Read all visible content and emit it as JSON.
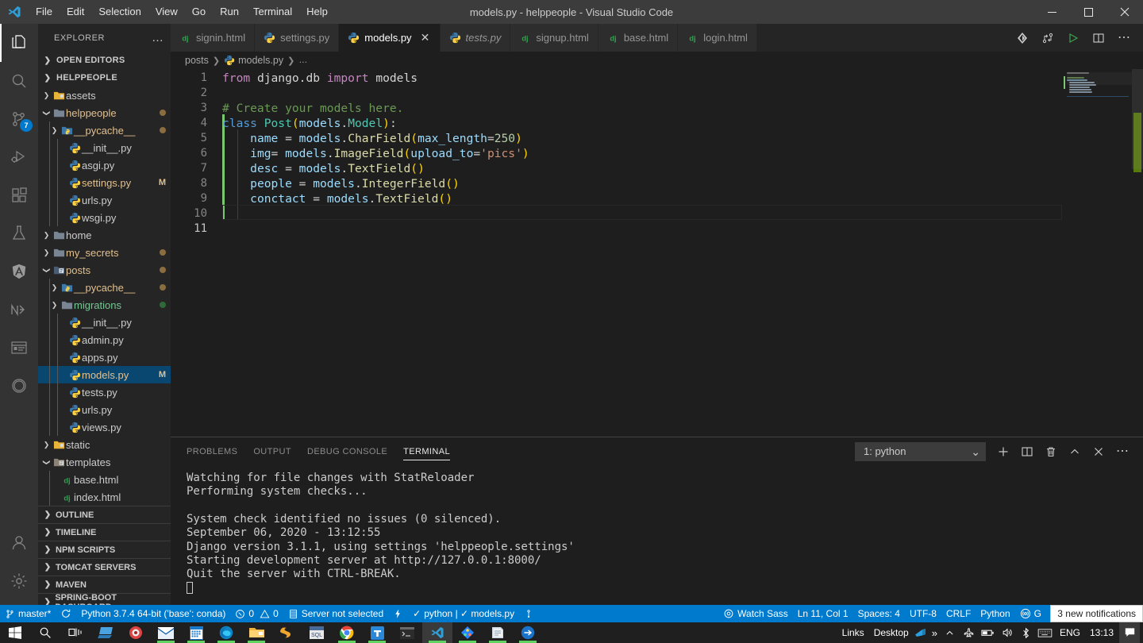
{
  "window": {
    "title": "models.py - helppeople - Visual Studio Code",
    "menu": [
      "File",
      "Edit",
      "Selection",
      "View",
      "Go",
      "Run",
      "Terminal",
      "Help"
    ],
    "controls": {
      "minimize": "─",
      "maximize": "☐",
      "close": "✕"
    }
  },
  "activitybar": {
    "items": [
      {
        "name": "explorer",
        "icon": "files-icon",
        "active": true,
        "badge": ""
      },
      {
        "name": "search",
        "icon": "search-icon",
        "active": false,
        "badge": ""
      },
      {
        "name": "source-control",
        "icon": "source-control-icon",
        "active": false,
        "badge": "7"
      },
      {
        "name": "run-and-debug",
        "icon": "run-debug-icon",
        "active": false,
        "badge": ""
      },
      {
        "name": "extensions",
        "icon": "extensions-icon",
        "active": false,
        "badge": ""
      },
      {
        "name": "testing",
        "icon": "beaker-icon",
        "active": false,
        "badge": ""
      },
      {
        "name": "angular",
        "icon": "angular-icon",
        "active": false,
        "badge": ""
      },
      {
        "name": "nx-console",
        "icon": "nx-icon",
        "active": false,
        "badge": ""
      },
      {
        "name": "browser-preview",
        "icon": "browser-icon",
        "active": false,
        "badge": ""
      },
      {
        "name": "circle-tool",
        "icon": "circle-icon",
        "active": false,
        "badge": ""
      }
    ],
    "bottom": [
      {
        "name": "accounts",
        "icon": "account-icon"
      },
      {
        "name": "manage-settings",
        "icon": "gear-icon"
      }
    ]
  },
  "sidebar": {
    "header": "EXPLORER",
    "more_actions": "…",
    "open_editors": {
      "label": "OPEN EDITORS",
      "expanded": false
    },
    "project": {
      "label": "HELPPEOPLE",
      "expanded": true
    },
    "tree": [
      {
        "label": "assets",
        "depth": 1,
        "type": "folder-assets",
        "chev": "collapsed",
        "status": "",
        "mod": ""
      },
      {
        "label": "helppeople",
        "depth": 1,
        "type": "folder",
        "chev": "expanded",
        "status": "amber",
        "mod": ""
      },
      {
        "label": "__pycache__",
        "depth": 2,
        "type": "folder-py",
        "chev": "collapsed",
        "status": "amber",
        "mod": ""
      },
      {
        "label": "__init__.py",
        "depth": 3,
        "type": "python",
        "chev": "none",
        "status": "",
        "mod": ""
      },
      {
        "label": "asgi.py",
        "depth": 3,
        "type": "python",
        "chev": "none",
        "status": "",
        "mod": ""
      },
      {
        "label": "settings.py",
        "depth": 3,
        "type": "python",
        "chev": "none",
        "status": "",
        "mod": "M"
      },
      {
        "label": "urls.py",
        "depth": 3,
        "type": "python",
        "chev": "none",
        "status": "",
        "mod": ""
      },
      {
        "label": "wsgi.py",
        "depth": 3,
        "type": "python",
        "chev": "none",
        "status": "",
        "mod": ""
      },
      {
        "label": "home",
        "depth": 1,
        "type": "folder-grey",
        "chev": "collapsed",
        "status": "",
        "mod": ""
      },
      {
        "label": "my_secrets",
        "depth": 1,
        "type": "folder-grey",
        "chev": "collapsed",
        "status": "amber",
        "mod": ""
      },
      {
        "label": "posts",
        "depth": 1,
        "type": "folder-open",
        "chev": "expanded",
        "status": "amber",
        "mod": ""
      },
      {
        "label": "__pycache__",
        "depth": 2,
        "type": "folder-py",
        "chev": "collapsed",
        "status": "amber",
        "mod": ""
      },
      {
        "label": "migrations",
        "depth": 2,
        "type": "folder-grey",
        "chev": "collapsed",
        "status": "green",
        "mod": "",
        "green_label": true
      },
      {
        "label": "__init__.py",
        "depth": 3,
        "type": "python",
        "chev": "none",
        "status": "",
        "mod": ""
      },
      {
        "label": "admin.py",
        "depth": 3,
        "type": "python",
        "chev": "none",
        "status": "",
        "mod": ""
      },
      {
        "label": "apps.py",
        "depth": 3,
        "type": "python",
        "chev": "none",
        "status": "",
        "mod": ""
      },
      {
        "label": "models.py",
        "depth": 3,
        "type": "python",
        "chev": "none",
        "status": "",
        "mod": "M",
        "selected": true
      },
      {
        "label": "tests.py",
        "depth": 3,
        "type": "python",
        "chev": "none",
        "status": "",
        "mod": ""
      },
      {
        "label": "urls.py",
        "depth": 3,
        "type": "python",
        "chev": "none",
        "status": "",
        "mod": ""
      },
      {
        "label": "views.py",
        "depth": 3,
        "type": "python",
        "chev": "none",
        "status": "",
        "mod": ""
      },
      {
        "label": "static",
        "depth": 1,
        "type": "folder-assets",
        "chev": "collapsed",
        "status": "",
        "mod": ""
      },
      {
        "label": "templates",
        "depth": 1,
        "type": "folder-tpl",
        "chev": "expanded",
        "status": "",
        "mod": ""
      },
      {
        "label": "base.html",
        "depth": 2,
        "type": "django",
        "chev": "none",
        "status": "",
        "mod": ""
      },
      {
        "label": "index.html",
        "depth": 2,
        "type": "django",
        "chev": "none",
        "status": "",
        "mod": ""
      }
    ],
    "panels": [
      "OUTLINE",
      "TIMELINE",
      "NPM SCRIPTS",
      "TOMCAT SERVERS",
      "MAVEN",
      "SPRING-BOOT DASHBOARD"
    ]
  },
  "editor": {
    "tabs": [
      {
        "label": "signin.html",
        "icon": "django-icon",
        "active": false,
        "preview": false,
        "dirty": false
      },
      {
        "label": "settings.py",
        "icon": "python-icon",
        "active": false,
        "preview": false,
        "dirty": false
      },
      {
        "label": "models.py",
        "icon": "python-icon",
        "active": true,
        "preview": false,
        "dirty": false,
        "close": "✕"
      },
      {
        "label": "tests.py",
        "icon": "python-icon",
        "active": false,
        "preview": true,
        "dirty": false
      },
      {
        "label": "signup.html",
        "icon": "django-icon",
        "active": false,
        "preview": false,
        "dirty": false
      },
      {
        "label": "base.html",
        "icon": "django-icon",
        "active": false,
        "preview": false,
        "dirty": false
      },
      {
        "label": "login.html",
        "icon": "django-icon",
        "active": false,
        "preview": false,
        "dirty": false
      }
    ],
    "tab_actions": [
      {
        "name": "source-control-graph-icon",
        "glyph": "◆"
      },
      {
        "name": "git-compare-icon",
        "glyph": "⑂"
      },
      {
        "name": "run-python-file-icon",
        "glyph": "▷"
      },
      {
        "name": "split-editor-icon",
        "glyph": "◫"
      },
      {
        "name": "more-actions-icon",
        "glyph": "…"
      }
    ],
    "breadcrumb": [
      "posts",
      "models.py",
      "…"
    ],
    "lines": [
      {
        "n": "1",
        "tokens": [
          {
            "t": "from",
            "c": "kw"
          },
          {
            "t": " django.db ",
            "c": "pl"
          },
          {
            "t": "import",
            "c": "kw"
          },
          {
            "t": " models",
            "c": "pl"
          }
        ]
      },
      {
        "n": "2",
        "tokens": []
      },
      {
        "n": "3",
        "tokens": [
          {
            "t": "# Create your models here.",
            "c": "cmt"
          }
        ]
      },
      {
        "n": "4",
        "tokens": [
          {
            "t": "class",
            "c": "kw2"
          },
          {
            "t": " ",
            "c": "pl"
          },
          {
            "t": "Post",
            "c": "cls"
          },
          {
            "t": "(",
            "c": "par"
          },
          {
            "t": "models",
            "c": "var"
          },
          {
            "t": ".",
            "c": "op"
          },
          {
            "t": "Model",
            "c": "cls"
          },
          {
            "t": ")",
            "c": "par"
          },
          {
            "t": ":",
            "c": "op"
          }
        ]
      },
      {
        "n": "5",
        "tokens": [
          {
            "t": "    ",
            "c": "pl"
          },
          {
            "t": "name",
            "c": "var"
          },
          {
            "t": " = ",
            "c": "op"
          },
          {
            "t": "models",
            "c": "var"
          },
          {
            "t": ".",
            "c": "op"
          },
          {
            "t": "CharField",
            "c": "fn"
          },
          {
            "t": "(",
            "c": "par"
          },
          {
            "t": "max_length",
            "c": "var"
          },
          {
            "t": "=",
            "c": "op"
          },
          {
            "t": "250",
            "c": "num"
          },
          {
            "t": ")",
            "c": "par"
          }
        ]
      },
      {
        "n": "6",
        "tokens": [
          {
            "t": "    ",
            "c": "pl"
          },
          {
            "t": "img",
            "c": "var"
          },
          {
            "t": "= ",
            "c": "op"
          },
          {
            "t": "models",
            "c": "var"
          },
          {
            "t": ".",
            "c": "op"
          },
          {
            "t": "ImageField",
            "c": "fn"
          },
          {
            "t": "(",
            "c": "par"
          },
          {
            "t": "upload_to",
            "c": "var"
          },
          {
            "t": "=",
            "c": "op"
          },
          {
            "t": "'pics'",
            "c": "str"
          },
          {
            "t": ")",
            "c": "par"
          }
        ]
      },
      {
        "n": "7",
        "tokens": [
          {
            "t": "    ",
            "c": "pl"
          },
          {
            "t": "desc",
            "c": "var"
          },
          {
            "t": " = ",
            "c": "op"
          },
          {
            "t": "models",
            "c": "var"
          },
          {
            "t": ".",
            "c": "op"
          },
          {
            "t": "TextField",
            "c": "fn"
          },
          {
            "t": "(",
            "c": "par"
          },
          {
            "t": ")",
            "c": "par"
          }
        ]
      },
      {
        "n": "8",
        "tokens": [
          {
            "t": "    ",
            "c": "pl"
          },
          {
            "t": "people",
            "c": "var"
          },
          {
            "t": " = ",
            "c": "op"
          },
          {
            "t": "models",
            "c": "var"
          },
          {
            "t": ".",
            "c": "op"
          },
          {
            "t": "IntegerField",
            "c": "fn"
          },
          {
            "t": "(",
            "c": "par"
          },
          {
            "t": ")",
            "c": "par"
          }
        ]
      },
      {
        "n": "9",
        "tokens": [
          {
            "t": "    ",
            "c": "pl"
          },
          {
            "t": "conctact",
            "c": "var"
          },
          {
            "t": " = ",
            "c": "op"
          },
          {
            "t": "models",
            "c": "var"
          },
          {
            "t": ".",
            "c": "op"
          },
          {
            "t": "TextField",
            "c": "fn"
          },
          {
            "t": "(",
            "c": "par"
          },
          {
            "t": ")",
            "c": "par"
          }
        ]
      },
      {
        "n": "10",
        "tokens": []
      },
      {
        "n": "11",
        "tokens": [],
        "current": true
      }
    ],
    "plain_text": "from django.db import models\n\n# Create your models here.\nclass Post(models.Model):\n    name = models.CharField(max_length=250)\n    img= models.ImageField(upload_to='pics')\n    desc = models.TextField()\n    people = models.IntegerField()\n    conctact = models.TextField()\n\n"
  },
  "panel": {
    "tabs": [
      "PROBLEMS",
      "OUTPUT",
      "DEBUG CONSOLE",
      "TERMINAL"
    ],
    "active_tab": "TERMINAL",
    "terminal_select": "1: python",
    "select_chevron": "⌄",
    "actions": [
      {
        "name": "new-terminal-icon",
        "glyph": "+"
      },
      {
        "name": "split-terminal-icon",
        "glyph": "◫"
      },
      {
        "name": "kill-terminal-icon",
        "glyph": "Ὕ1"
      },
      {
        "name": "maximize-panel-icon",
        "glyph": "⌃"
      },
      {
        "name": "close-panel-icon",
        "glyph": "✕"
      },
      {
        "name": "panel-more-icon",
        "glyph": "…"
      }
    ],
    "terminal_lines": [
      "Watching for file changes with StatReloader",
      "Performing system checks...",
      "",
      "System check identified no issues (0 silenced).",
      "September 06, 2020 - 13:12:55",
      "Django version 3.1.1, using settings 'helppeople.settings'",
      "Starting development server at http://127.0.0.1:8000/",
      "Quit the server with CTRL-BREAK."
    ]
  },
  "statusbar": {
    "left": [
      {
        "name": "branch",
        "icon": "source-control-icon",
        "text": "master*"
      },
      {
        "name": "sync",
        "icon": "sync-icon",
        "text": ""
      },
      {
        "name": "python-interpreter",
        "icon": "",
        "text": "Python 3.7.4 64-bit ('base': conda)"
      },
      {
        "name": "errors-warnings",
        "icon": "error-warning-icon",
        "text": "0  0"
      },
      {
        "name": "tomcat-server",
        "icon": "server-icon",
        "text": "Server not selected"
      },
      {
        "name": "live-share",
        "icon": "liveshare-icon",
        "text": ""
      },
      {
        "name": "python-test-status",
        "icon": "check-icon",
        "text": "python | ✓ models.py"
      },
      {
        "name": "git-lens",
        "icon": "gitlens-icon",
        "text": ""
      }
    ],
    "right": [
      {
        "name": "watch-sass",
        "icon": "eye-icon",
        "text": "Watch Sass"
      },
      {
        "name": "cursor-position",
        "icon": "",
        "text": "Ln 11, Col 1"
      },
      {
        "name": "indentation",
        "icon": "",
        "text": "Spaces: 4"
      },
      {
        "name": "encoding",
        "icon": "",
        "text": "UTF-8"
      },
      {
        "name": "eol",
        "icon": "",
        "text": "CRLF"
      },
      {
        "name": "language-mode",
        "icon": "",
        "text": "Python"
      },
      {
        "name": "go-live",
        "icon": "broadcast-icon",
        "text": "G"
      }
    ],
    "notification_tooltip": "3 new notifications",
    "accent_color": "#007acc"
  },
  "taskbar": {
    "items": [
      {
        "name": "start-button",
        "icon": "windows-icon",
        "running": false,
        "active": false
      },
      {
        "name": "search-button",
        "icon": "search-icon",
        "running": false,
        "active": false
      },
      {
        "name": "task-view-button",
        "icon": "task-view-icon",
        "running": false,
        "active": false
      },
      {
        "name": "app-sublime",
        "icon": "sublime-icon",
        "running": false,
        "active": false
      },
      {
        "name": "app-media",
        "icon": "media-icon",
        "running": false,
        "active": false
      },
      {
        "name": "app-mail",
        "icon": "mail-icon",
        "running": true,
        "active": false
      },
      {
        "name": "app-calendar",
        "icon": "calendar-icon",
        "running": true,
        "active": false
      },
      {
        "name": "app-edge",
        "icon": "edge-icon",
        "running": true,
        "active": false
      },
      {
        "name": "app-explorer",
        "icon": "folder-icon",
        "running": true,
        "active": false
      },
      {
        "name": "app-sublime-text",
        "icon": "sublime-text-icon",
        "running": false,
        "active": false
      },
      {
        "name": "app-sql",
        "icon": "sql-icon",
        "running": false,
        "active": false
      },
      {
        "name": "app-chrome",
        "icon": "chrome-icon",
        "running": true,
        "active": false
      },
      {
        "name": "app-teams",
        "icon": "teams-icon",
        "running": true,
        "active": false
      },
      {
        "name": "app-cmd",
        "icon": "cmd-icon",
        "running": false,
        "active": false
      },
      {
        "name": "app-vscode",
        "icon": "vscode-icon",
        "running": true,
        "active": true
      },
      {
        "name": "app-sourcetree",
        "icon": "sourcetree-icon",
        "running": true,
        "active": false
      },
      {
        "name": "app-notepad",
        "icon": "notepad-icon",
        "running": true,
        "active": false
      },
      {
        "name": "app-postman",
        "icon": "postman-icon",
        "running": true,
        "active": false
      }
    ],
    "links_label": "Links",
    "desktop_label": "Desktop",
    "overflow_glyph": "»",
    "tray": [
      {
        "name": "show-hidden-icons",
        "glyph": "⌃"
      },
      {
        "name": "network-icon",
        "glyph": "✈"
      },
      {
        "name": "battery-icon",
        "glyph": "▬"
      },
      {
        "name": "volume-icon",
        "glyph": "🔊"
      },
      {
        "name": "bluetooth-icon",
        "glyph": "ᛞ"
      },
      {
        "name": "keyboard-icon",
        "glyph": "⌨"
      }
    ],
    "language": "ENG",
    "clock": "13:13",
    "action-center": "🗪"
  }
}
